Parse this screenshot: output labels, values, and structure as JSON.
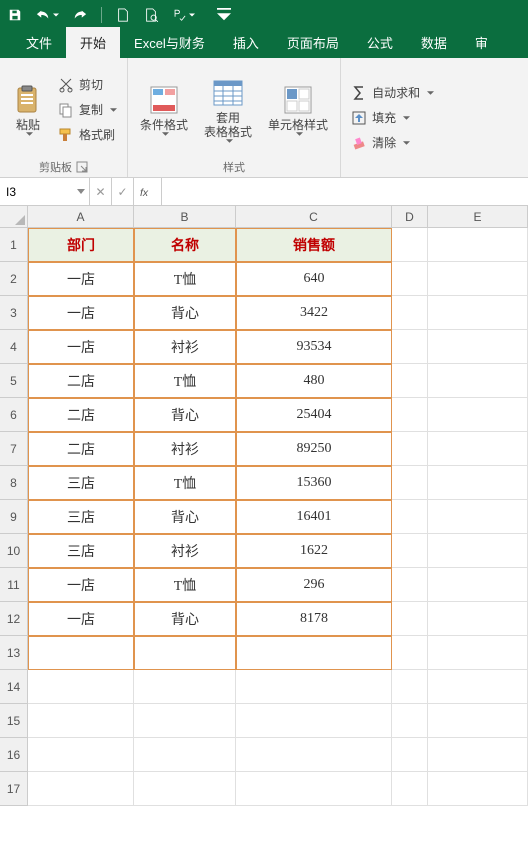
{
  "qat_icons": [
    "save",
    "undo",
    "redo",
    "new-doc",
    "print-preview",
    "spellcheck",
    "customize"
  ],
  "ribbon": {
    "tabs": [
      "文件",
      "开始",
      "Excel与财务",
      "插入",
      "页面布局",
      "公式",
      "数据",
      "审"
    ],
    "active_tab": "开始",
    "clipboard": {
      "paste": "粘贴",
      "cut": "剪切",
      "copy": "复制",
      "format_painter": "格式刷",
      "label": "剪贴板"
    },
    "styles": {
      "cond_format": "条件格式",
      "table_format": "套用\n表格格式",
      "cell_styles": "单元格样式",
      "label": "样式"
    },
    "editing": {
      "autosum": "自动求和",
      "fill": "填充",
      "clear": "清除"
    }
  },
  "namebox": "I3",
  "formula_fx": "fx",
  "sheet": {
    "cols": [
      "A",
      "B",
      "C",
      "D",
      "E"
    ],
    "rows": [
      1,
      2,
      3,
      4,
      5,
      6,
      7,
      8,
      9,
      10,
      11,
      12,
      13,
      14,
      15,
      16,
      17
    ],
    "headers": [
      "部门",
      "名称",
      "销售额"
    ],
    "data": [
      [
        "一店",
        "T恤",
        "640"
      ],
      [
        "一店",
        "背心",
        "3422"
      ],
      [
        "一店",
        "衬衫",
        "93534"
      ],
      [
        "二店",
        "T恤",
        "480"
      ],
      [
        "二店",
        "背心",
        "25404"
      ],
      [
        "二店",
        "衬衫",
        "89250"
      ],
      [
        "三店",
        "T恤",
        "15360"
      ],
      [
        "三店",
        "背心",
        "16401"
      ],
      [
        "三店",
        "衬衫",
        "1622"
      ],
      [
        "一店",
        "T恤",
        "296"
      ],
      [
        "一店",
        "背心",
        "8178"
      ]
    ]
  },
  "chart_data": {
    "type": "table",
    "columns": [
      "部门",
      "名称",
      "销售额"
    ],
    "rows": [
      [
        "一店",
        "T恤",
        640
      ],
      [
        "一店",
        "背心",
        3422
      ],
      [
        "一店",
        "衬衫",
        93534
      ],
      [
        "二店",
        "T恤",
        480
      ],
      [
        "二店",
        "背心",
        25404
      ],
      [
        "二店",
        "衬衫",
        89250
      ],
      [
        "三店",
        "T恤",
        15360
      ],
      [
        "三店",
        "背心",
        16401
      ],
      [
        "三店",
        "衬衫",
        1622
      ],
      [
        "一店",
        "T恤",
        296
      ],
      [
        "一店",
        "背心",
        8178
      ]
    ]
  }
}
